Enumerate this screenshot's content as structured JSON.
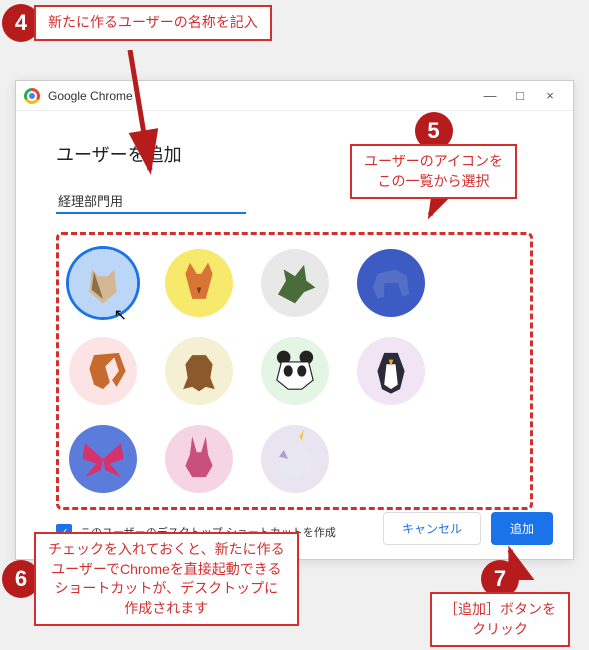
{
  "window": {
    "title": "Google Chrome",
    "close": "×",
    "maximize": "□",
    "minimize": "—"
  },
  "dialog": {
    "heading": "ユーザーを追加",
    "name_value": "経理部門用",
    "checkbox_label": "このユーザーのデスクトップ ショートカットを作成",
    "checkbox_checked": true,
    "cancel_label": "キャンセル",
    "add_label": "追加"
  },
  "avatars": [
    {
      "name": "cat-origami",
      "bg": "#bcd6f7",
      "selected": true
    },
    {
      "name": "fox-origami",
      "bg": "#f7e96b",
      "selected": false
    },
    {
      "name": "dragon-origami",
      "bg": "#e8e8e8",
      "selected": false
    },
    {
      "name": "elephant-origami",
      "bg": "#3c5cc4",
      "selected": false
    },
    {
      "name": "squirrel-origami",
      "bg": "#fce4e4",
      "selected": false
    },
    {
      "name": "monkey-origami",
      "bg": "#f5f0d4",
      "selected": false
    },
    {
      "name": "panda-origami",
      "bg": "#e4f5e4",
      "selected": false
    },
    {
      "name": "penguin-origami",
      "bg": "#f0e4f5",
      "selected": false
    },
    {
      "name": "butterfly-origami",
      "bg": "#5c7cdb",
      "selected": false
    },
    {
      "name": "rabbit-origami",
      "bg": "#f5d4e4",
      "selected": false
    },
    {
      "name": "unicorn-origami",
      "bg": "#e8e4f0",
      "selected": false
    }
  ],
  "callouts": {
    "c4": {
      "num": "4",
      "text": "新たに作るユーザーの名称を記入"
    },
    "c5": {
      "num": "5",
      "text": "ユーザーのアイコンを\nこの一覧から選択"
    },
    "c6": {
      "num": "6",
      "text": "チェックを入れておくと、新たに作る\nユーザーでChromeを直接起動できる\nショートカットが、デスクトップに\n作成されます"
    },
    "c7": {
      "num": "7",
      "text": "［追加］ボタンを\nクリック"
    }
  }
}
